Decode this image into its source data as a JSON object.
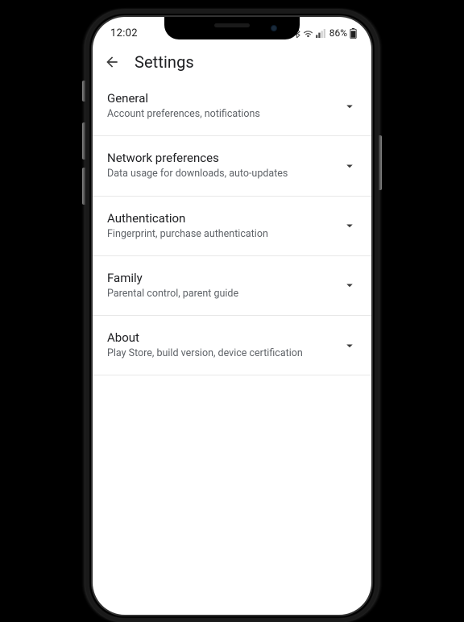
{
  "status": {
    "time": "12:02",
    "battery_pct": "86%"
  },
  "header": {
    "title": "Settings"
  },
  "items": [
    {
      "title": "General",
      "subtitle": "Account preferences, notifications"
    },
    {
      "title": "Network preferences",
      "subtitle": "Data usage for downloads, auto-updates"
    },
    {
      "title": "Authentication",
      "subtitle": "Fingerprint, purchase authentication"
    },
    {
      "title": "Family",
      "subtitle": "Parental control, parent guide"
    },
    {
      "title": "About",
      "subtitle": "Play Store, build version, device certification"
    }
  ]
}
